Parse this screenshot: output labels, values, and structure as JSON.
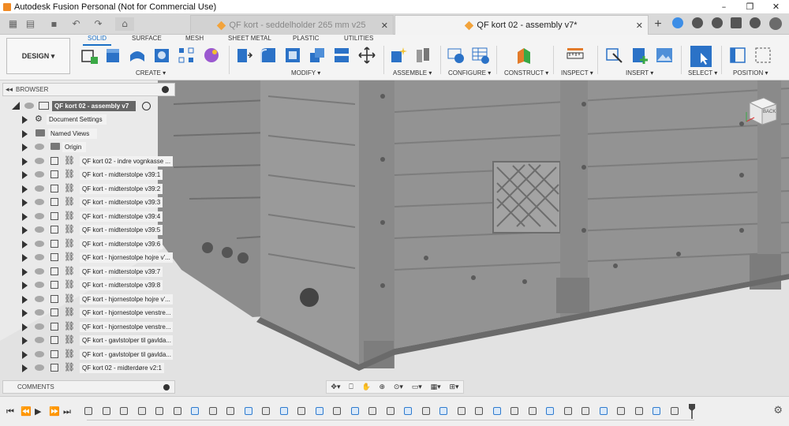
{
  "window": {
    "title": "Autodesk Fusion Personal (Not for Commercial Use)",
    "controls": [
      "–",
      "❐",
      "✕"
    ]
  },
  "tabs": [
    {
      "label": "QF kort - seddelholder 265 mm v25",
      "active": false
    },
    {
      "label": "QF kort 02 - assembly v7*",
      "active": true
    }
  ],
  "ribbon": {
    "workspace": "DESIGN ▾",
    "tabs": [
      "SOLID",
      "SURFACE",
      "MESH",
      "SHEET METAL",
      "PLASTIC",
      "UTILITIES"
    ],
    "active_tab": "SOLID",
    "groups": [
      "CREATE ▾",
      "MODIFY ▾",
      "ASSEMBLE ▾",
      "CONFIGURE ▾",
      "CONSTRUCT ▾",
      "INSPECT ▾",
      "INSERT ▾",
      "SELECT ▾",
      "POSITION ▾"
    ]
  },
  "browser": {
    "header": "BROWSER",
    "root": "QF kort 02 - assembly v7",
    "items": [
      {
        "label": "Document Settings",
        "icon": "gear-icon"
      },
      {
        "label": "Named Views",
        "icon": "folder-icon"
      },
      {
        "label": "Origin",
        "icon": "folder-icon"
      },
      {
        "label": "QF kort 02 - indre vognkasse ...",
        "icon": "link-icon"
      },
      {
        "label": "QF kort - midterstolpe v39:1",
        "icon": "link-icon"
      },
      {
        "label": "QF kort - midterstolpe v39:2",
        "icon": "link-icon"
      },
      {
        "label": "QF kort - midterstolpe v39:3",
        "icon": "link-icon"
      },
      {
        "label": "QF kort - midterstolpe v39:4",
        "icon": "link-icon"
      },
      {
        "label": "QF kort - midterstolpe v39:5",
        "icon": "link-icon"
      },
      {
        "label": "QF kort - midterstolpe v39:6",
        "icon": "link-icon"
      },
      {
        "label": "QF kort - hjornestolpe hojre v'...",
        "icon": "link-icon"
      },
      {
        "label": "QF kort - midterstolpe v39:7",
        "icon": "link-icon"
      },
      {
        "label": "QF kort - midterstolpe v39:8",
        "icon": "link-icon"
      },
      {
        "label": "QF kort - hjornestolpe hojre v'...",
        "icon": "link-icon"
      },
      {
        "label": "QF kort - hjornestolpe venstre...",
        "icon": "link-icon"
      },
      {
        "label": "QF kort - hjornestolpe venstre...",
        "icon": "link-icon"
      },
      {
        "label": "QF kort - gavlstolper til gavlda...",
        "icon": "link-icon"
      },
      {
        "label": "QF kort - gavlstolper til gavlda...",
        "icon": "link-icon"
      },
      {
        "label": "QF kort 02 - midterdøre v2:1",
        "icon": "link-icon"
      }
    ]
  },
  "comments": {
    "header": "COMMENTS"
  },
  "viewcube": {
    "face": "BACK"
  },
  "colors": {
    "accent": "#1a6fc5",
    "model": "#8b8b8b",
    "background": "#eaeaea"
  },
  "timeline": {
    "item_count": 34
  }
}
